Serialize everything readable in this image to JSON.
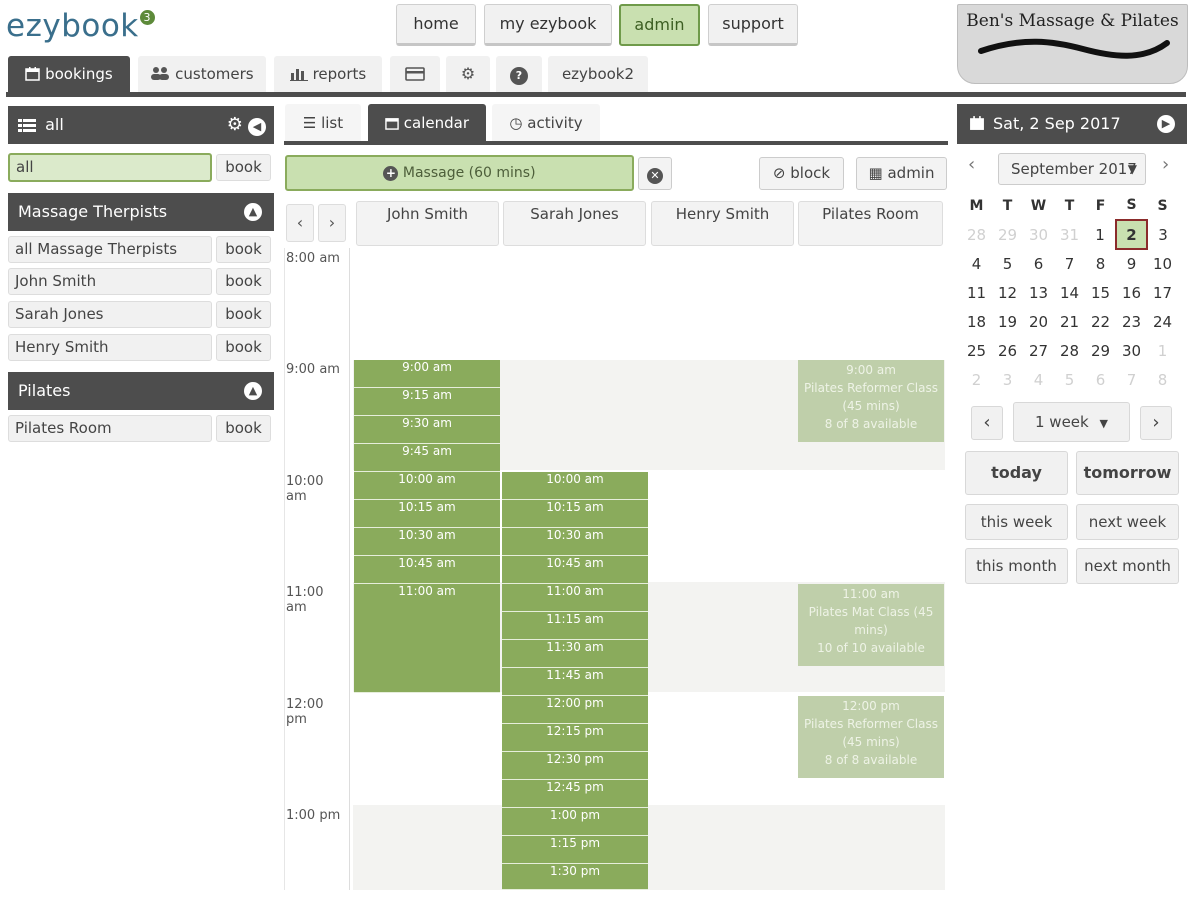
{
  "logo": {
    "text": "ezybook",
    "badge": "3"
  },
  "top_nav": [
    "home",
    "my ezybook",
    "admin",
    "support"
  ],
  "brand": {
    "name": "Ben's Massage & Pilates"
  },
  "main_tabs": {
    "bookings": "bookings",
    "customers": "customers",
    "reports": "reports",
    "ezybook2": "ezybook2"
  },
  "left": {
    "filter_header": "all",
    "filter_value": "all",
    "book": "book",
    "group1": {
      "title": "Massage Therpists",
      "items": [
        "all Massage Therpists",
        "John Smith",
        "Sarah Jones",
        "Henry Smith"
      ]
    },
    "group2": {
      "title": "Pilates",
      "items": [
        "Pilates Room"
      ]
    }
  },
  "center": {
    "tabs": {
      "list": "list",
      "calendar": "calendar",
      "activity": "activity"
    },
    "service": "Massage (60 mins)",
    "block": "block",
    "admin": "admin",
    "columns": [
      "John Smith",
      "Sarah Jones",
      "Henry Smith",
      "Pilates Room"
    ],
    "times": [
      "8:00 am",
      "9:00 am",
      "10:00 am",
      "11:00 am",
      "12:00 pm",
      "1:00 pm"
    ],
    "john_slots": [
      "9:00 am",
      "9:15 am",
      "9:30 am",
      "9:45 am",
      "10:00 am",
      "10:15 am",
      "10:30 am",
      "10:45 am",
      "11:00 am"
    ],
    "sarah_slots": [
      "10:00 am",
      "10:15 am",
      "10:30 am",
      "10:45 am",
      "11:00 am",
      "11:15 am",
      "11:30 am",
      "11:45 am",
      "12:00 pm",
      "12:15 pm",
      "12:30 pm",
      "12:45 pm",
      "1:00 pm",
      "1:15 pm",
      "1:30 pm"
    ],
    "classes": [
      {
        "time": "9:00 am",
        "name": "Pilates Reformer Class",
        "duration": "(45 mins)",
        "avail": "8 of 8 available"
      },
      {
        "time": "11:00 am",
        "name": "Pilates Mat Class (45",
        "duration": "mins)",
        "avail": "10 of 10 available"
      },
      {
        "time": "12:00 pm",
        "name": "Pilates Reformer Class",
        "duration": "(45 mins)",
        "avail": "8 of 8 available"
      }
    ]
  },
  "right": {
    "date_title": "Sat, 2 Sep 2017",
    "month": "September 2017",
    "dow": [
      "M",
      "T",
      "W",
      "T",
      "F",
      "S",
      "S"
    ],
    "weeks": [
      [
        "28",
        "29",
        "30",
        "31",
        "1",
        "2",
        "3"
      ],
      [
        "4",
        "5",
        "6",
        "7",
        "8",
        "9",
        "10"
      ],
      [
        "11",
        "12",
        "13",
        "14",
        "15",
        "16",
        "17"
      ],
      [
        "18",
        "19",
        "20",
        "21",
        "22",
        "23",
        "24"
      ],
      [
        "25",
        "26",
        "27",
        "28",
        "29",
        "30",
        "1"
      ],
      [
        "2",
        "3",
        "4",
        "5",
        "6",
        "7",
        "8"
      ]
    ],
    "range": "1 week",
    "today": "today",
    "tomorrow": "tomorrow",
    "this_week": "this week",
    "next_week": "next week",
    "this_month": "this month",
    "next_month": "next month"
  },
  "colors": {
    "dark": "#4d4d4d",
    "green": "#8aab5c",
    "green_light": "#bfcfaa",
    "accent_bg": "#c9e0b0"
  }
}
